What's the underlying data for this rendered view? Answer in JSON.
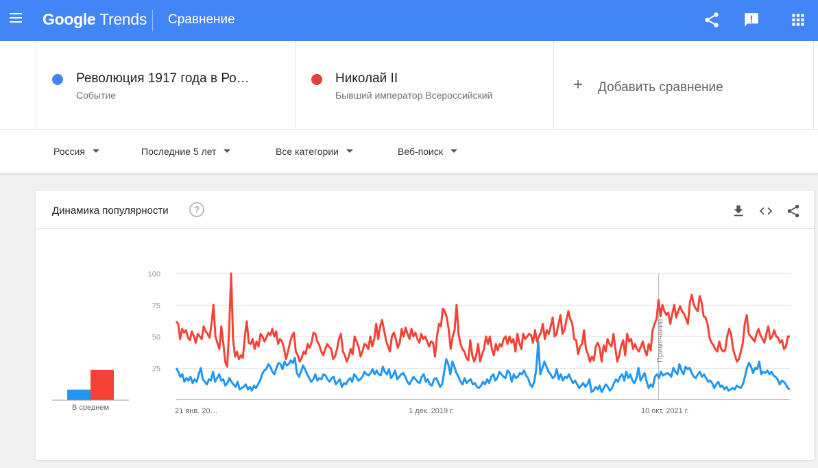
{
  "header": {
    "brand_google": "Google",
    "brand_trends": "Trends",
    "page_title": "Сравнение"
  },
  "terms": [
    {
      "name": "Революция 1917 года в Ро…",
      "subtitle": "Событие",
      "color": "#4285f4"
    },
    {
      "name": "Николай II",
      "subtitle": "Бывший император Всероссийский",
      "color": "#db4437"
    }
  ],
  "add_comparison": {
    "icon": "+",
    "label": "Добавить сравнение"
  },
  "filters": {
    "region": "Россия",
    "period": "Последние 5 лет",
    "category": "Все категории",
    "search_type": "Веб-поиск"
  },
  "card": {
    "title": "Динамика популярности",
    "help_icon": "?",
    "average_label": "В среднем",
    "note_label": "Примечание"
  },
  "chart_data": {
    "type": "line",
    "x_tick_labels": [
      "21 янв. 20…",
      "1 дек. 2019 г.",
      "10 окт. 2021 г."
    ],
    "y_ticks": [
      25,
      50,
      75,
      100
    ],
    "ylim": [
      0,
      100
    ],
    "averages": [
      {
        "name": "Революция 1917 года в Ро…",
        "value": 16,
        "color": "#2196f3"
      },
      {
        "name": "Николай II",
        "value": 46,
        "color": "#f44336"
      }
    ],
    "series": [
      {
        "name": "Николай II",
        "color": "#f44336",
        "values": [
          62,
          60,
          48,
          56,
          53,
          55,
          49,
          47,
          54,
          50,
          45,
          52,
          50,
          48,
          58,
          54,
          52,
          49,
          60,
          75,
          50,
          45,
          40,
          58,
          45,
          30,
          26,
          55,
          100,
          48,
          34,
          38,
          32,
          35,
          33,
          50,
          62,
          45,
          44,
          48,
          40,
          46,
          42,
          52,
          50,
          46,
          49,
          53,
          51,
          56,
          50,
          54,
          44,
          48,
          46,
          40,
          32,
          38,
          45,
          50,
          53,
          38,
          35,
          30,
          33,
          38,
          36,
          44,
          41,
          45,
          53,
          52,
          46,
          43,
          38,
          35,
          40,
          44,
          42,
          40,
          32,
          34,
          40,
          48,
          52,
          38,
          35,
          30,
          34,
          40,
          36,
          50,
          46,
          42,
          34,
          38,
          44,
          43,
          40,
          50,
          42,
          48,
          60,
          48,
          58,
          63,
          55,
          47,
          42,
          38,
          50,
          53,
          48,
          41,
          45,
          56,
          50,
          57,
          52,
          48,
          56,
          50,
          53,
          48,
          45,
          52,
          48,
          50,
          46,
          42,
          46,
          45,
          34,
          50,
          60,
          58,
          72,
          70,
          65,
          55,
          40,
          50,
          55,
          75,
          52,
          44,
          40,
          38,
          33,
          31,
          47,
          35,
          30,
          35,
          44,
          30,
          36,
          40,
          50,
          44,
          50,
          40,
          35,
          44,
          39,
          44,
          42,
          48,
          50,
          44,
          50,
          45,
          48,
          38,
          52,
          45,
          40,
          52,
          48,
          50,
          52,
          51,
          45,
          55,
          46,
          50,
          53,
          60,
          48,
          55,
          52,
          58,
          65,
          50,
          52,
          60,
          67,
          52,
          55,
          63,
          70,
          64,
          60,
          48,
          47,
          36,
          42,
          44,
          55,
          40,
          36,
          30,
          34,
          31,
          42,
          45,
          41,
          30,
          43,
          38,
          48,
          44,
          42,
          52,
          40,
          30,
          35,
          43,
          47,
          35,
          52,
          46,
          48,
          40,
          44,
          40,
          38,
          42,
          46,
          39,
          35,
          44,
          39,
          55,
          60,
          64,
          79,
          66,
          75,
          70,
          67,
          69,
          60,
          68,
          75,
          65,
          70,
          74,
          70,
          68,
          64,
          60,
          77,
          83,
          75,
          72,
          70,
          82,
          77,
          66,
          65,
          60,
          49,
          45,
          43,
          40,
          38,
          46,
          40,
          38,
          39,
          50,
          56,
          52,
          40,
          35,
          30,
          32,
          38,
          45,
          60,
          67,
          52,
          50,
          48,
          46,
          52,
          56,
          51,
          48,
          45,
          52,
          58,
          48,
          50,
          55,
          50,
          49,
          45,
          47,
          40,
          42,
          50,
          50
        ]
      },
      {
        "name": "Революция 1917 года в Ро…",
        "color": "#2196f3",
        "values": [
          25,
          22,
          18,
          20,
          14,
          17,
          15,
          18,
          13,
          16,
          14,
          20,
          25,
          16,
          14,
          12,
          16,
          15,
          22,
          14,
          17,
          20,
          15,
          16,
          11,
          13,
          17,
          14,
          12,
          10,
          14,
          8,
          9,
          10,
          12,
          8,
          10,
          7,
          11,
          9,
          12,
          15,
          20,
          23,
          24,
          28,
          26,
          22,
          20,
          25,
          29,
          28,
          24,
          30,
          27,
          28,
          31,
          29,
          33,
          21,
          18,
          22,
          27,
          24,
          20,
          17,
          14,
          16,
          20,
          15,
          17,
          16,
          20,
          19,
          16,
          14,
          17,
          18,
          12,
          14,
          16,
          10,
          13,
          12,
          15,
          17,
          14,
          20,
          18,
          15,
          16,
          18,
          22,
          20,
          19,
          21,
          24,
          20,
          23,
          20,
          19,
          26,
          22,
          20,
          24,
          17,
          19,
          23,
          16,
          18,
          20,
          21,
          18,
          14,
          12,
          15,
          18,
          16,
          14,
          13,
          18,
          20,
          14,
          16,
          12,
          11,
          16,
          17,
          14,
          10,
          12,
          22,
          32,
          28,
          20,
          30,
          26,
          21,
          18,
          14,
          12,
          17,
          13,
          15,
          16,
          12,
          13,
          10,
          9,
          11,
          14,
          12,
          16,
          13,
          18,
          20,
          15,
          17,
          22,
          20,
          18,
          17,
          23,
          21,
          14,
          20,
          17,
          18,
          21,
          20,
          23,
          19,
          17,
          12,
          10,
          14,
          24,
          46,
          20,
          25,
          30,
          26,
          22,
          20,
          17,
          18,
          24,
          16,
          20,
          15,
          18,
          17,
          20,
          16,
          13,
          15,
          12,
          9,
          11,
          13,
          10,
          12,
          16,
          6,
          7,
          10,
          8,
          11,
          6,
          9,
          12,
          10,
          7,
          9,
          13,
          16,
          14,
          18,
          20,
          15,
          22,
          17,
          20,
          15,
          13,
          17,
          25,
          15,
          18,
          21,
          14,
          9,
          12,
          10,
          18,
          20,
          17,
          22,
          19,
          20,
          21,
          20,
          18,
          25,
          22,
          20,
          28,
          23,
          20,
          26,
          24,
          25,
          21,
          18,
          17,
          20,
          22,
          18,
          20,
          17,
          14,
          15,
          13,
          9,
          12,
          14,
          10,
          11,
          8,
          10,
          7,
          8,
          9,
          8,
          11,
          10,
          9,
          12,
          18,
          25,
          29,
          26,
          21,
          25,
          24,
          30,
          20,
          22,
          21,
          23,
          20,
          22,
          19,
          18,
          16,
          12,
          15,
          14,
          12,
          9,
          8
        ]
      }
    ]
  }
}
